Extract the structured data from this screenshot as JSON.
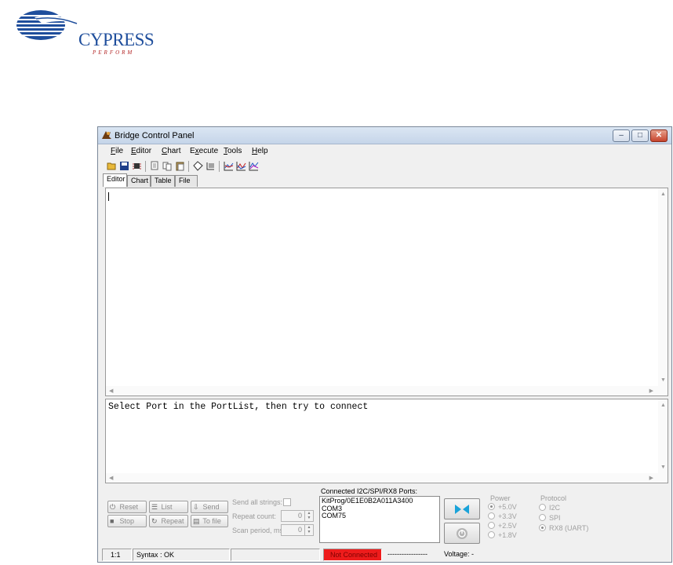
{
  "logo": {
    "brand": "CYPRESS",
    "tagline": "PERFORM"
  },
  "window": {
    "title": "Bridge Control Panel",
    "controls": {
      "minimize": "‒",
      "maximize": "□",
      "close": "✕"
    }
  },
  "menu": [
    {
      "label": "File",
      "accel": "F",
      "rest": "ile"
    },
    {
      "label": "Editor",
      "accel": "E",
      "rest": "ditor"
    },
    {
      "label": "Chart",
      "accel": "C",
      "rest": "hart"
    },
    {
      "label": "Execute",
      "accel": "x",
      "pre": "E",
      "rest": "ecute"
    },
    {
      "label": "Tools",
      "accel": "T",
      "rest": "ools"
    },
    {
      "label": "Help",
      "accel": "H",
      "rest": "elp"
    }
  ],
  "toolbar": [
    "open-icon",
    "save-icon",
    "chip-icon",
    "copy-icon",
    "cut-icon",
    "paste-icon",
    "tag-icon",
    "list-icon",
    "chart-icon",
    "chart2-icon",
    "chart3-icon"
  ],
  "tabs": [
    "Editor",
    "Chart",
    "Table",
    "File"
  ],
  "output": {
    "text": "Select Port in the PortList, then try to connect"
  },
  "controls": {
    "reset": "Reset",
    "list": "List",
    "send": "Send",
    "stop": "Stop",
    "repeat": "Repeat",
    "to_file": "To file",
    "send_all": "Send all strings:",
    "repeat_count_label": "Repeat count:",
    "repeat_count": "0",
    "scan_period_label": "Scan period, ms:",
    "scan_period": "0"
  },
  "ports": {
    "label": "Connected I2C/SPI/RX8 Ports:",
    "items": [
      "KitProg/0E1E0B2A011A3400",
      "COM3",
      "COM75"
    ]
  },
  "power": {
    "title": "Power",
    "options": [
      "+5.0V",
      "+3.3V",
      "+2.5V",
      "+1.8V"
    ],
    "selected": 0
  },
  "protocol": {
    "title": "Protocol",
    "options": [
      "I2C",
      "SPI",
      "RX8 (UART)"
    ],
    "selected": 2
  },
  "status": {
    "position": "1:1",
    "syntax": "Syntax : OK",
    "connection": "Not Connected",
    "dashes": "-----------------",
    "voltage": "Voltage: -"
  },
  "colors": {
    "status_error": "#ee1c1c",
    "brand_blue": "#1f4e9c",
    "brand_red": "#b22222"
  }
}
